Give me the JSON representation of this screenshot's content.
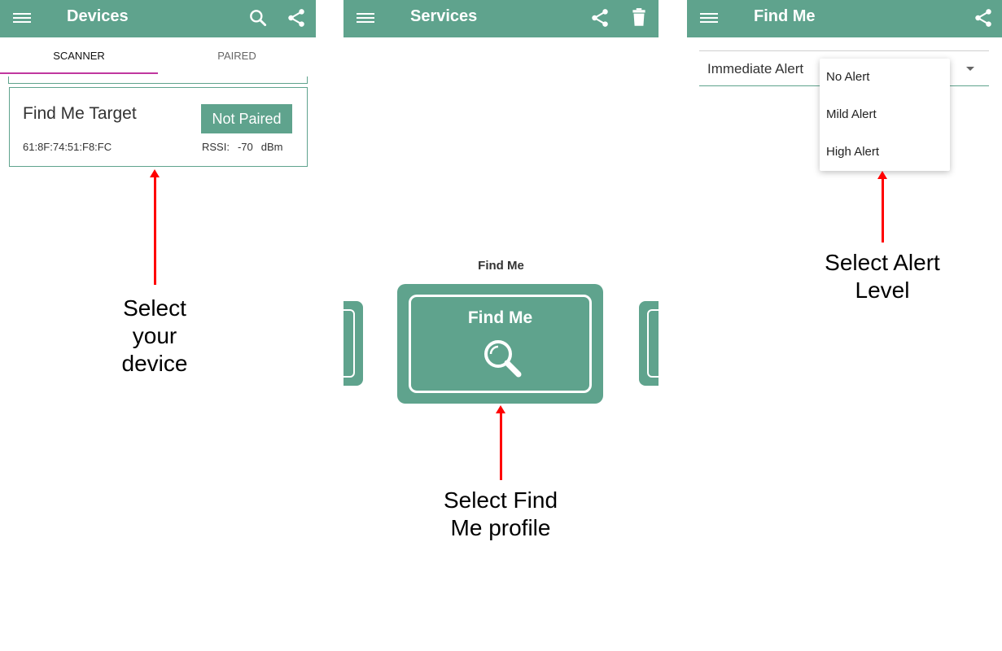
{
  "panel1": {
    "appbar": {
      "title": "Devices",
      "actions": [
        "search-icon",
        "share-icon"
      ]
    },
    "tabs": [
      {
        "label": "SCANNER",
        "active": true
      },
      {
        "label": "PAIRED",
        "active": false
      }
    ],
    "device": {
      "name": "Find Me Target",
      "status_button": "Not Paired",
      "mac": "61:8F:74:51:F8:FC",
      "rssi_label": "RSSI:",
      "rssi_value": "-70",
      "rssi_unit": "dBm"
    },
    "caption_lines": [
      "Select",
      "your",
      "device"
    ]
  },
  "panel2": {
    "appbar": {
      "title": "Services",
      "actions": [
        "share-icon",
        "trash-icon"
      ]
    },
    "service_label": "Find Me",
    "service_card_title": "Find Me",
    "caption_lines": [
      "Select Find",
      "Me profile"
    ]
  },
  "panel3": {
    "appbar": {
      "title": "Find Me",
      "actions": [
        "share-icon"
      ]
    },
    "spinner_label": "Immediate Alert",
    "dropdown_options": [
      "No Alert",
      "Mild Alert",
      "High Alert"
    ],
    "caption_lines": [
      "Select Alert",
      "Level"
    ]
  },
  "colors": {
    "accent": "#5fa38d",
    "tab_indicator": "#c0379f",
    "arrow": "#ff0000"
  }
}
